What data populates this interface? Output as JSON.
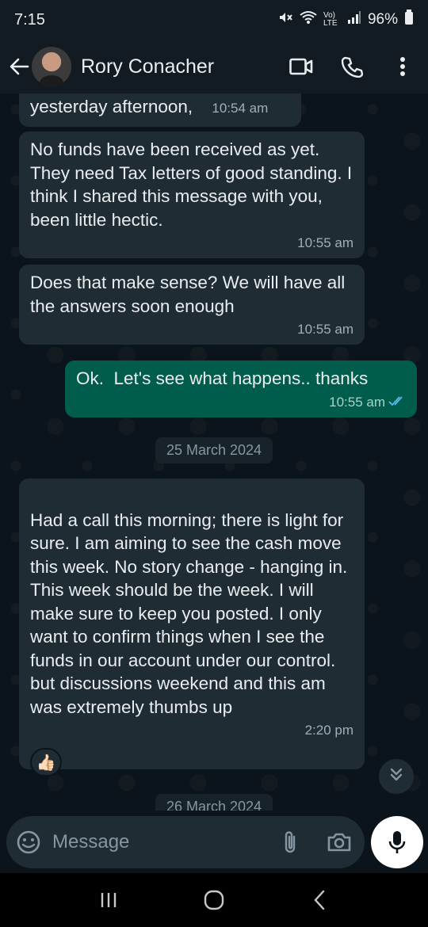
{
  "status_bar": {
    "time": "7:15",
    "network": "Vo) LTE",
    "battery": "96%"
  },
  "header": {
    "contact_name": "Rory Conacher"
  },
  "messages": [
    {
      "direction": "incoming",
      "text": "yesterday afternoon,",
      "time": "10:54 am"
    },
    {
      "direction": "incoming",
      "text": "No funds have been received as yet. They need Tax letters of good standing. I think I shared this message with you, been little hectic.",
      "time": "10:55 am"
    },
    {
      "direction": "incoming",
      "text": "Does that make sense? We will have all the answers soon enough",
      "time": "10:55 am"
    },
    {
      "direction": "outgoing",
      "text": "Ok.  Let's see what happens.. thanks",
      "time": "10:55 am",
      "status": "read"
    },
    {
      "direction": "incoming",
      "text": "Had a call this morning; there is light for sure. I am aiming to see the cash move this week. No story change - hanging in. This week should be the week. I will make sure to keep you posted. I only want to confirm things when I see the funds in our account under our control.\nbut discussions weekend and this am was extremely thumbs up",
      "time": "2:20 pm",
      "reaction": "👍🏻"
    }
  ],
  "date_chips": [
    "25 March 2024",
    "26 March 2024"
  ],
  "composer": {
    "placeholder": "Message"
  },
  "colors": {
    "chat_bg": "#0b141a",
    "incoming_bubble": "#202c33",
    "outgoing_bubble": "#005c4b",
    "read_tick": "#53bdeb"
  }
}
